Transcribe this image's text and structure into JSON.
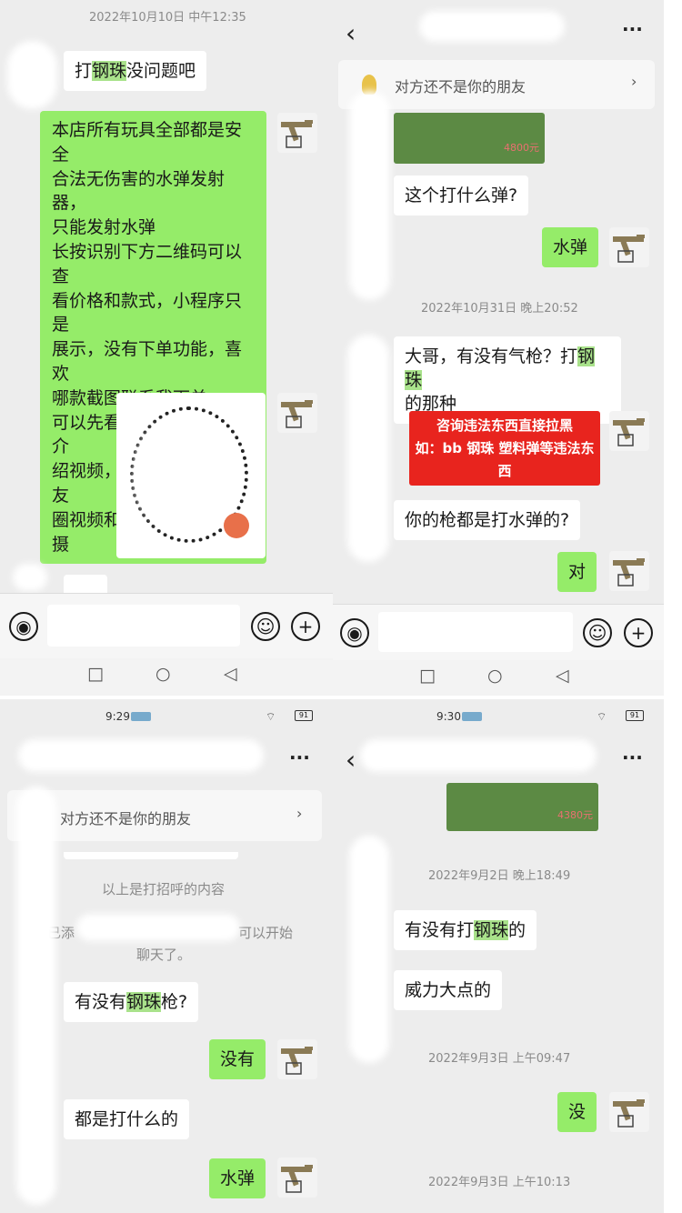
{
  "panel1": {
    "timestamp": "2022年10月10日 中午12:35",
    "msg_question_pre": "打",
    "msg_question_hl": "钢珠",
    "msg_question_post": "没问题吧",
    "shop_lines": [
      "本店所有玩具全部都是安全",
      "合法无伤害的水弹发射器，",
      "只能发射水弹",
      "长按识别下方二维码可以查",
      "看价格和款式，小程序只是",
      "展示，没有下单功能，喜欢",
      "哪款截图联系我下单",
      "可以先看朋友圈了解，有介",
      "绍视频，图中有价格，朋友",
      "圈视频和图片都是实物拍摄"
    ]
  },
  "panel2": {
    "back": "‹",
    "more": "···",
    "notice": "对方还不是你的朋友",
    "chev": "›",
    "price_tag": "4800元",
    "msg_q1": "这个打什么弹?",
    "msg_a1": "水弹",
    "timestamp": "2022年10月31日 晚上20:52",
    "msg_q2_pre": "大哥，有没有气枪？打",
    "msg_q2_hl": "钢珠",
    "msg_q2_line2": "的那种",
    "warn_line1": "咨询违法东西直接拉黑",
    "warn_line2": "如：bb 钢珠 塑料弹等违法东西",
    "msg_q3": "你的枪都是打水弹的?",
    "msg_a3": "对"
  },
  "panel3": {
    "status_time": "9:29",
    "battery": "91",
    "more": "···",
    "notice": "对方还不是你的朋友",
    "chev": "›",
    "sys_greet": "以上是打招呼的内容",
    "sys_added_a": "已添",
    "sys_added_b": "可以开始",
    "sys_added_c": "聊天了。",
    "msg_q1_pre": "有没有",
    "msg_q1_hl": "钢珠",
    "msg_q1_post": "枪?",
    "msg_a1": "没有",
    "msg_q2": "都是打什么的",
    "msg_a2": "水弹"
  },
  "panel4": {
    "status_time": "9:30",
    "battery": "91",
    "back": "‹",
    "more": "···",
    "price_tag": "4380元",
    "timestamp1": "2022年9月2日 晚上18:49",
    "msg_q1_pre": "有没有打",
    "msg_q1_hl": "钢珠",
    "msg_q1_post": "的",
    "msg_q2": "威力大点的",
    "timestamp2": "2022年9月3日 上午09:47",
    "msg_a1": "没",
    "timestamp3": "2022年9月3日 上午10:13"
  },
  "colors": {
    "green_bubble": "#95ec69",
    "chat_bg": "#ededed",
    "warn_red": "#e8241e"
  },
  "icons": [
    "voice-icon",
    "emoji-icon",
    "plus-icon",
    "back-icon",
    "more-icon",
    "chevron-right-icon",
    "square-nav-icon",
    "circle-nav-icon",
    "triangle-nav-icon",
    "wifi-icon",
    "battery-icon",
    "shop-avatar-icon"
  ]
}
